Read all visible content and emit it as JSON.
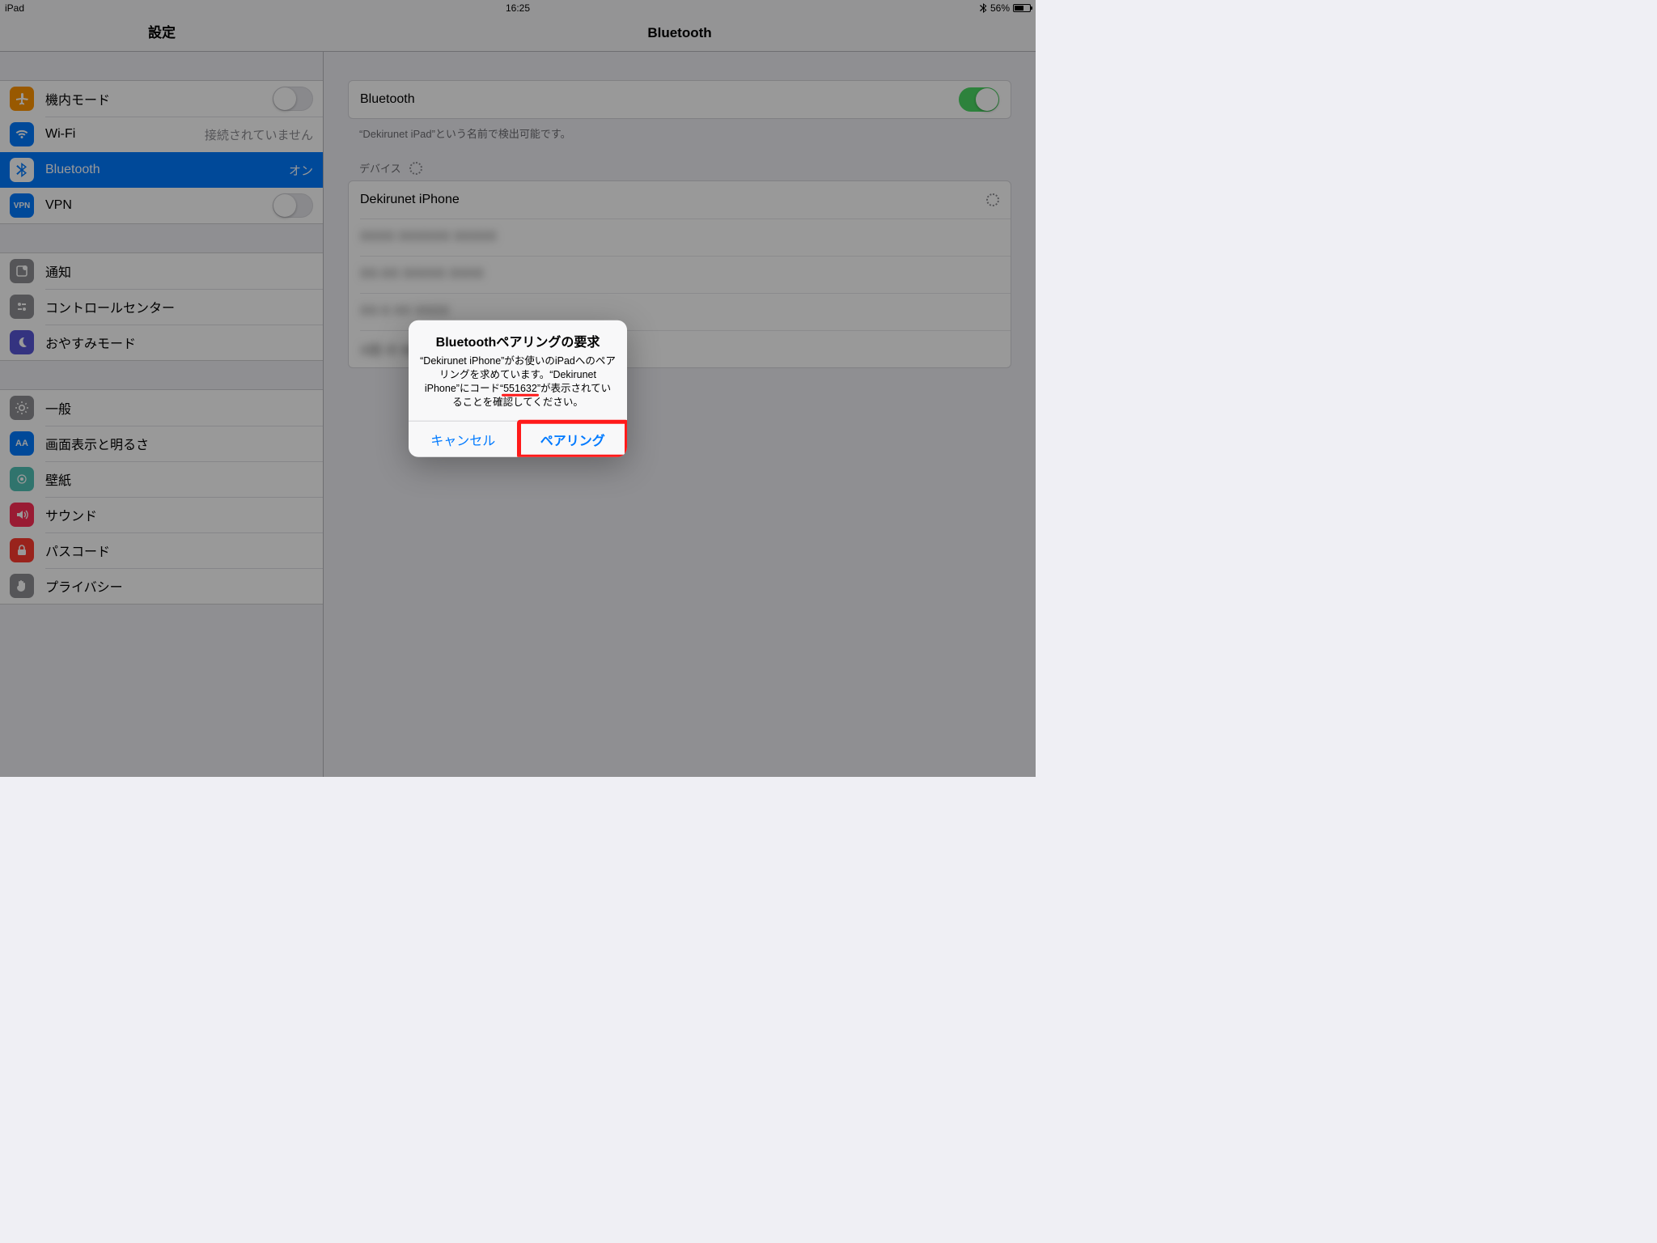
{
  "status": {
    "device": "iPad",
    "time": "16:25",
    "battery_pct": "56%"
  },
  "header": {
    "settings_title": "設定",
    "detail_title": "Bluetooth"
  },
  "sidebar": {
    "g1": {
      "airplane": "機内モード",
      "wifi": "Wi-Fi",
      "wifi_status": "接続されていません",
      "bluetooth": "Bluetooth",
      "bluetooth_status": "オン",
      "vpn": "VPN",
      "vpn_badge": "VPN"
    },
    "g2": {
      "notifications": "通知",
      "control_center": "コントロールセンター",
      "dnd": "おやすみモード"
    },
    "g3": {
      "general": "一般",
      "display": "画面表示と明るさ",
      "display_badge": "AA",
      "wallpaper": "壁紙",
      "sounds": "サウンド",
      "passcode": "パスコード",
      "privacy": "プライバシー"
    }
  },
  "detail": {
    "bt_label": "Bluetooth",
    "discoverable_note": "“Dekirunet iPad”という名前で検出可能です。",
    "devices_label": "デバイス",
    "device0": "Dekirunet iPhone",
    "device_blur1": "XXXX XXXXXX XXXXX",
    "device_blur2": "XX-XX XXXXX XXXX",
    "device_blur3": "XX-X XX XXXX",
    "device_blur4": "X田 の MacBook Air"
  },
  "alert": {
    "title": "Bluetoothペアリングの要求",
    "msg_pre": "“Dekirunet iPhone”がお使いのiPadへのペアリングを求めています。“Dekirunet iPhone”にコード“",
    "code": "551632",
    "msg_post": "”が表示されていることを確認してください。",
    "cancel": "キャンセル",
    "pair": "ペアリング"
  }
}
